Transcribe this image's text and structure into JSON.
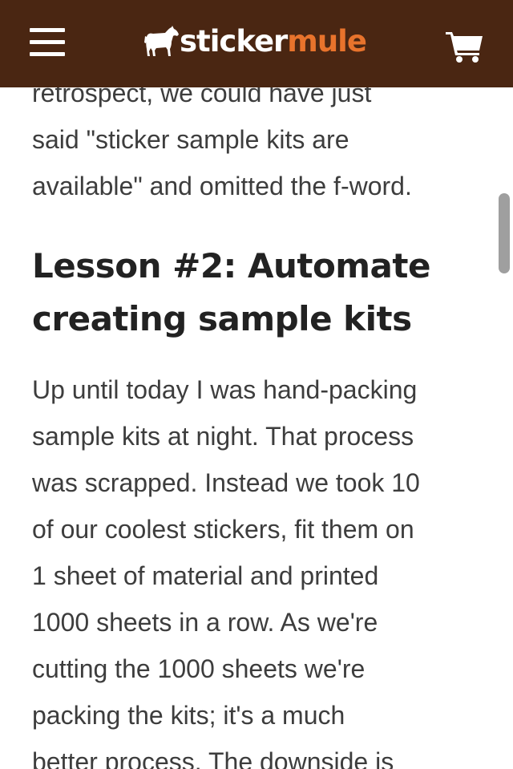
{
  "header": {
    "brand_part1": "sticker",
    "brand_part2": "mule",
    "menu_icon": "hamburger-menu-icon",
    "cart_icon": "shopping-cart-icon",
    "logo_icon": "mule-logo-icon",
    "colors": {
      "background": "#4a2612",
      "brand_accent": "#e8732c"
    }
  },
  "article": {
    "intro_lines": [
      "retrospect, we could have just",
      "said \"sticker sample kits are",
      "available\" and omitted the f-word."
    ],
    "heading_lines": [
      "Lesson #2: Automate",
      "creating sample kits"
    ],
    "body_lines": [
      "Up until today I was hand-packing",
      "sample kits at night. That process",
      "was scrapped. Instead we took 10",
      "of our coolest stickers, fit them on",
      "1 sheet of material and printed",
      "1000 sheets in a row. As we're",
      "cutting the 1000 sheets we're",
      "packing the kits; it's a much",
      "better process. The downside is"
    ]
  }
}
